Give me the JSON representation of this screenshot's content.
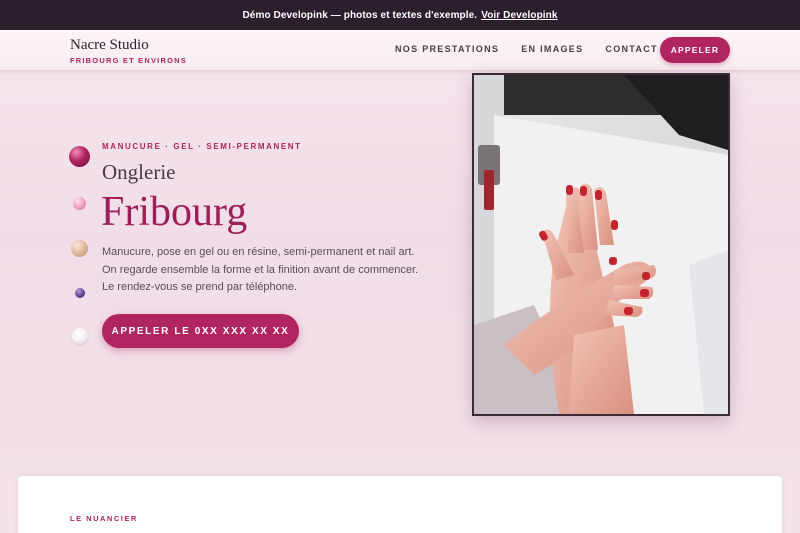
{
  "demo_banner": {
    "text": "Démo Developink — photos et textes d'exemple.",
    "link": "Voir Developink"
  },
  "header": {
    "brand_name": "Nacre Studio",
    "brand_sub": "FRIBOURG ET ENVIRONS",
    "nav": [
      "NOS PRESTATIONS",
      "EN IMAGES",
      "CONTACT"
    ],
    "call_label": "APPELER"
  },
  "hero": {
    "eyebrow": "MANUCURE · GEL · SEMI-PERMANENT",
    "title_line1": "Onglerie",
    "title_line2": "Fribourg",
    "description": "Manucure, pose en gel ou en résine, semi-permanent et nail art. On regarde ensemble la forme et la finition avant de commencer. Le rendez-vous se prend par téléphone.",
    "cta_label": "APPELER LE 0XX XXX XX XX"
  },
  "section": {
    "label": "LE NUANCIER"
  },
  "colors": {
    "accent": "#b0245f",
    "banner_bg": "#2a1f2b",
    "page_bg": "#f3e3ea"
  }
}
